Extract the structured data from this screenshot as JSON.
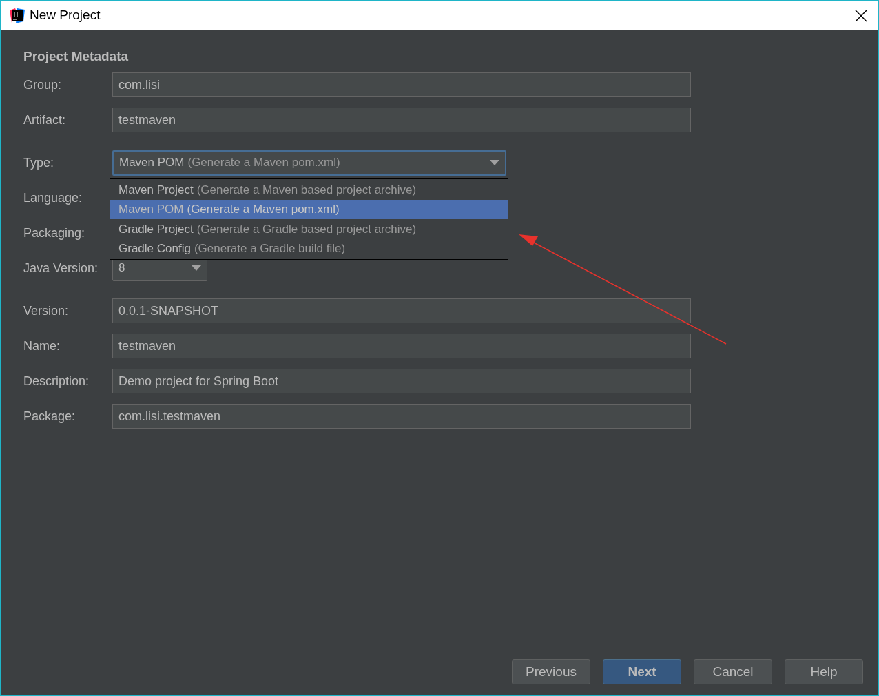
{
  "window": {
    "title": "New Project"
  },
  "heading": "Project Metadata",
  "sections": [
    [
      {
        "label": "Group:",
        "kind": "text",
        "value": "com.lisi"
      },
      {
        "label": "Artifact:",
        "kind": "text",
        "value": "testmaven"
      }
    ],
    [
      {
        "label": "Type:",
        "kind": "combo",
        "value": "Maven POM",
        "hint": "(Generate a Maven pom.xml)",
        "focused": true,
        "expanded": true,
        "options": [
          {
            "name": "Maven Project",
            "description": "(Generate a Maven based project archive)",
            "selected": false
          },
          {
            "name": "Maven POM",
            "description": "(Generate a Maven pom.xml)",
            "selected": true
          },
          {
            "name": "Gradle Project",
            "description": "(Generate a Gradle based project archive)",
            "selected": false
          },
          {
            "name": "Gradle Config",
            "description": "(Generate a Gradle build file)",
            "selected": false
          }
        ]
      },
      {
        "label": "Language:",
        "kind": "covered"
      },
      {
        "label": "Packaging:",
        "kind": "covered"
      },
      {
        "label": "Java Version:",
        "kind": "small-combo",
        "value": "8"
      }
    ],
    [
      {
        "label": "Version:",
        "kind": "text",
        "value": "0.0.1-SNAPSHOT"
      },
      {
        "label": "Name:",
        "kind": "text",
        "value": "testmaven"
      },
      {
        "label": "Description:",
        "kind": "text",
        "value": "Demo project for Spring Boot"
      },
      {
        "label": "Package:",
        "kind": "text",
        "value": "com.lisi.testmaven"
      }
    ]
  ],
  "buttons": [
    {
      "label": "Previous",
      "default": false,
      "mnemonic": true
    },
    {
      "label": "Next",
      "default": true,
      "mnemonic": true
    },
    {
      "label": "Cancel",
      "default": false,
      "mnemonic": false
    },
    {
      "label": "Help",
      "default": false,
      "mnemonic": false
    }
  ]
}
